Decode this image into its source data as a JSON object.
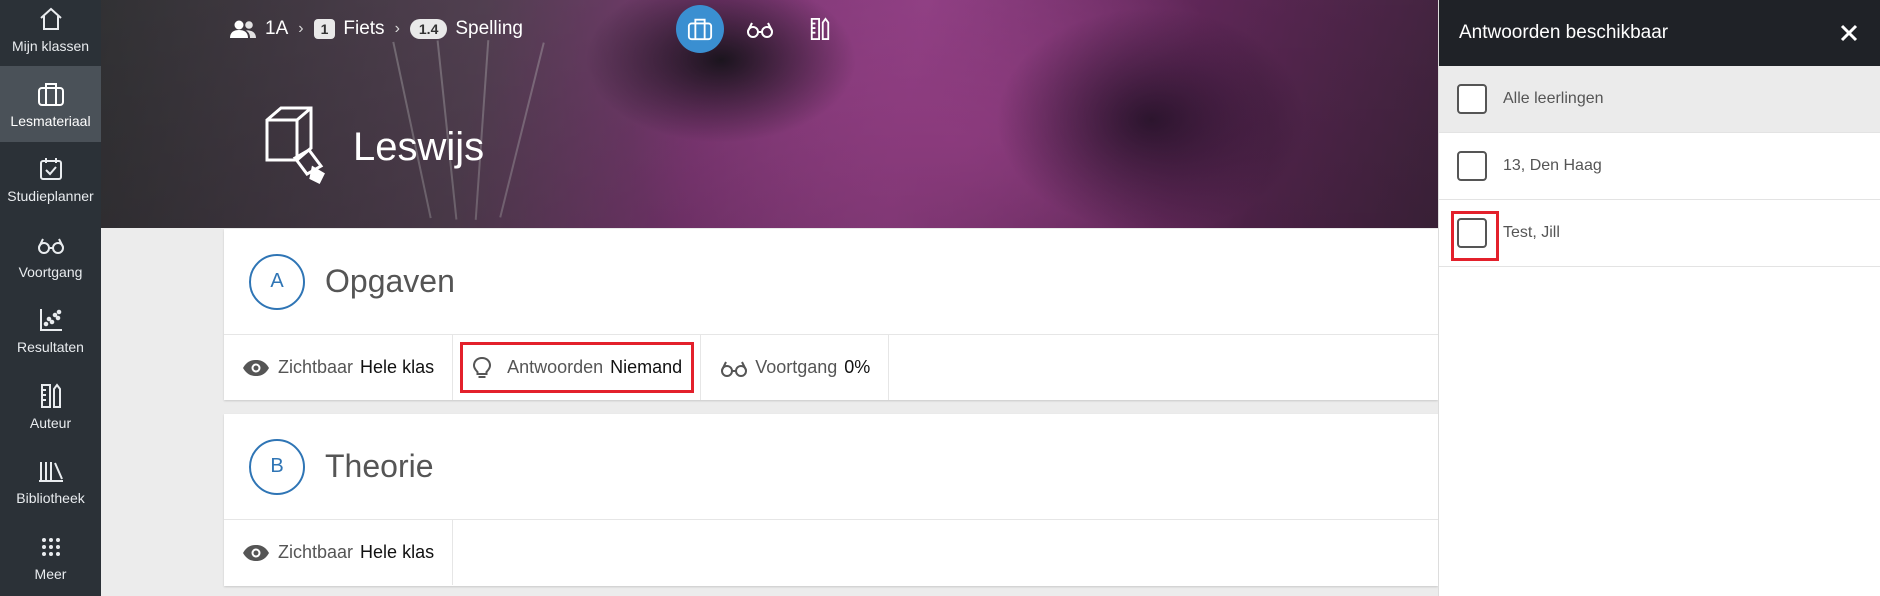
{
  "sidenav": {
    "items": [
      {
        "label": "Mijn klassen",
        "icon": "home-icon"
      },
      {
        "label": "Lesmateriaal",
        "icon": "briefcase-icon",
        "active": true
      },
      {
        "label": "Studieplanner",
        "icon": "calendar-check-icon"
      },
      {
        "label": "Voortgang",
        "icon": "glasses-icon"
      },
      {
        "label": "Resultaten",
        "icon": "scatter-chart-icon"
      },
      {
        "label": "Auteur",
        "icon": "ruler-pencil-icon"
      },
      {
        "label": "Bibliotheek",
        "icon": "books-icon"
      },
      {
        "label": "Meer",
        "icon": "grid-dots-icon"
      }
    ]
  },
  "breadcrumb": {
    "group": "1A",
    "chapter_number": "1",
    "chapter": "Fiets",
    "section_number": "1.4",
    "section": "Spelling"
  },
  "hero": {
    "title": "Leswijs"
  },
  "cards": [
    {
      "letter": "A",
      "title": "Opgaven",
      "props": {
        "visible_label": "Zichtbaar",
        "visible_value": "Hele klas",
        "answers_label": "Antwoorden",
        "answers_value": "Niemand",
        "progress_label": "Voortgang",
        "progress_value": "0%"
      }
    },
    {
      "letter": "B",
      "title": "Theorie",
      "props": {
        "visible_label": "Zichtbaar",
        "visible_value": "Hele klas"
      }
    }
  ],
  "panel": {
    "title": "Antwoorden beschikbaar",
    "all_label": "Alle leerlingen",
    "students": [
      "13, Den Haag",
      "Test, Jill"
    ]
  },
  "colors": {
    "accent_blue": "#3a8fd1",
    "highlight_red": "#e3202b",
    "nav_bg": "#2b3137"
  }
}
